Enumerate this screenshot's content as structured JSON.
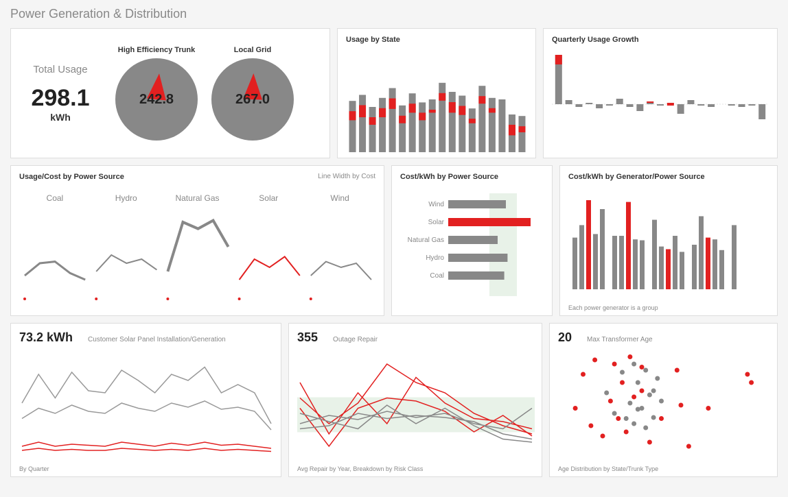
{
  "page_title": "Power Generation & Distribution",
  "row1": {
    "total_usage": {
      "label": "Total Usage",
      "value": "298.1",
      "unit": "kWh"
    },
    "gauge1": {
      "label": "High Efficiency Trunk",
      "value": "242.8"
    },
    "gauge2": {
      "label": "Local Grid",
      "value": "267.0"
    },
    "usage_by_state_title": "Usage by State",
    "quarterly_growth_title": "Quarterly Usage Growth"
  },
  "row2": {
    "usage_cost_title": "Usage/Cost by Power Source",
    "usage_cost_note": "Line Width by Cost",
    "sources": [
      "Coal",
      "Hydro",
      "Natural Gas",
      "Solar",
      "Wind"
    ],
    "cost_kwh_title": "Cost/kWh by Power Source",
    "cost_kwh_sources": [
      "Wind",
      "Solar",
      "Natural Gas",
      "Hydro",
      "Coal"
    ],
    "cost_gen_title": "Cost/kWh by Generator/Power Source",
    "cost_gen_note": "Each power generator is a group"
  },
  "row3": {
    "solar_value": "73.2 kWh",
    "solar_title": "Customer Solar Panel Installation/Generation",
    "solar_note": "By Quarter",
    "outage_value": "355",
    "outage_title": "Outage Repair",
    "outage_note": "Avg Repair by Year, Breakdown by Risk Class",
    "transformer_value": "20",
    "transformer_title": "Max Transformer Age",
    "transformer_note": "Age Distribution by State/Trunk Type"
  },
  "chart_data": [
    {
      "type": "bar",
      "title": "Usage by State",
      "series": [
        {
          "name": "base",
          "values": [
            68,
            76,
            60,
            72,
            85,
            62,
            78,
            66,
            70,
            92,
            80,
            75,
            58,
            88,
            72,
            70,
            50,
            48
          ]
        },
        {
          "name": "highlight",
          "values": [
            12,
            16,
            10,
            12,
            14,
            10,
            12,
            10,
            4,
            10,
            14,
            12,
            6,
            10,
            6,
            0,
            14,
            8
          ]
        }
      ]
    },
    {
      "type": "bar",
      "title": "Quarterly Usage Growth",
      "series": [
        {
          "name": "gray",
          "values": [
            72,
            6,
            -4,
            2,
            -6,
            -2,
            8,
            -4,
            -10,
            4,
            -2,
            2,
            -14,
            6,
            -2,
            -4,
            0,
            -2,
            -4,
            -2,
            -22
          ]
        },
        {
          "name": "highlight",
          "values": [
            14,
            0,
            0,
            0,
            0,
            0,
            0,
            0,
            0,
            2,
            0,
            4,
            0,
            0,
            0,
            0,
            0,
            0,
            0,
            0,
            0
          ]
        }
      ]
    },
    {
      "type": "line",
      "title": "Usage/Cost by Power Source",
      "categories": [
        "Coal",
        "Hydro",
        "Natural Gas",
        "Solar",
        "Wind"
      ],
      "series": [
        {
          "name": "Coal",
          "values": [
            25,
            40,
            42,
            28,
            20
          ]
        },
        {
          "name": "Hydro",
          "values": [
            30,
            50,
            40,
            45,
            32
          ]
        },
        {
          "name": "Natural Gas",
          "values": [
            30,
            90,
            82,
            92,
            60
          ]
        },
        {
          "name": "Solar",
          "values": [
            20,
            45,
            35,
            48,
            25
          ],
          "color": "#e22020"
        },
        {
          "name": "Wind",
          "values": [
            25,
            42,
            35,
            40,
            20
          ]
        }
      ]
    },
    {
      "type": "bar",
      "title": "Cost/kWh by Power Source",
      "categories": [
        "Wind",
        "Solar",
        "Natural Gas",
        "Hydro",
        "Coal"
      ],
      "values": [
        70,
        100,
        60,
        72,
        68
      ],
      "highlight_index": 1
    },
    {
      "type": "bar",
      "title": "Cost/kWh by Generator/Power Source",
      "groups": 5,
      "values": [
        58,
        72,
        100,
        62,
        90,
        60,
        60,
        98,
        56,
        55,
        78,
        48,
        45,
        60,
        42,
        50,
        82,
        58,
        56,
        44,
        72
      ]
    },
    {
      "type": "line",
      "title": "Customer Solar Panel Installation/Generation",
      "series": [
        {
          "name": "a",
          "values": [
            50,
            78,
            55,
            80,
            62,
            60,
            82,
            72,
            60,
            78,
            72,
            85,
            60,
            68,
            60,
            30
          ]
        },
        {
          "name": "b",
          "values": [
            35,
            45,
            40,
            48,
            42,
            40,
            50,
            45,
            42,
            50,
            46,
            52,
            44,
            46,
            42,
            24
          ]
        },
        {
          "name": "c",
          "values": [
            8,
            12,
            8,
            10,
            9,
            8,
            12,
            10,
            8,
            11,
            9,
            12,
            9,
            10,
            8,
            6
          ],
          "color": "#e22020"
        },
        {
          "name": "d",
          "values": [
            4,
            6,
            4,
            5,
            4,
            4,
            6,
            5,
            4,
            5,
            4,
            6,
            4,
            5,
            4,
            3
          ],
          "color": "#e22020"
        }
      ]
    },
    {
      "type": "line",
      "title": "Outage Repair",
      "series": [
        {
          "name": "r1",
          "values": [
            55,
            30,
            50,
            88,
            70,
            60,
            40,
            28,
            20
          ],
          "color": "#e22020"
        },
        {
          "name": "r2",
          "values": [
            70,
            20,
            60,
            30,
            75,
            50,
            35,
            32,
            25
          ],
          "color": "#e22020"
        },
        {
          "name": "r3",
          "values": [
            45,
            8,
            45,
            55,
            52,
            42,
            22,
            38,
            18
          ],
          "color": "#e22020"
        },
        {
          "name": "g1",
          "values": [
            30,
            38,
            34,
            42,
            36,
            40,
            30,
            25,
            45
          ],
          "color": "#888"
        },
        {
          "name": "g2",
          "values": [
            25,
            28,
            40,
            35,
            38,
            36,
            32,
            20,
            15
          ],
          "color": "#888"
        },
        {
          "name": "g3",
          "values": [
            40,
            32,
            25,
            48,
            30,
            45,
            28,
            15,
            12
          ],
          "color": "#888"
        }
      ]
    },
    {
      "type": "scatter",
      "title": "Max Transformer Age",
      "series": [
        {
          "name": "red",
          "color": "#e22020",
          "points": [
            [
              6,
              45
            ],
            [
              10,
              78
            ],
            [
              14,
              28
            ],
            [
              16,
              92
            ],
            [
              20,
              18
            ],
            [
              24,
              52
            ],
            [
              26,
              88
            ],
            [
              30,
              70
            ],
            [
              32,
              22
            ],
            [
              34,
              95
            ],
            [
              40,
              62
            ],
            [
              44,
              12
            ],
            [
              50,
              35
            ],
            [
              58,
              82
            ],
            [
              60,
              48
            ],
            [
              64,
              8
            ],
            [
              74,
              45
            ],
            [
              94,
              78
            ],
            [
              96,
              70
            ],
            [
              40,
              85
            ],
            [
              28,
              35
            ],
            [
              36,
              56
            ]
          ]
        },
        {
          "name": "gray",
          "color": "#888",
          "points": [
            [
              22,
              60
            ],
            [
              26,
              40
            ],
            [
              30,
              80
            ],
            [
              34,
              50
            ],
            [
              36,
              30
            ],
            [
              38,
              70
            ],
            [
              40,
              45
            ],
            [
              42,
              82
            ],
            [
              44,
              58
            ],
            [
              46,
              36
            ],
            [
              48,
              74
            ],
            [
              50,
              52
            ],
            [
              36,
              88
            ],
            [
              38,
              44
            ],
            [
              42,
              26
            ],
            [
              46,
              62
            ],
            [
              32,
              35
            ]
          ]
        }
      ]
    }
  ]
}
